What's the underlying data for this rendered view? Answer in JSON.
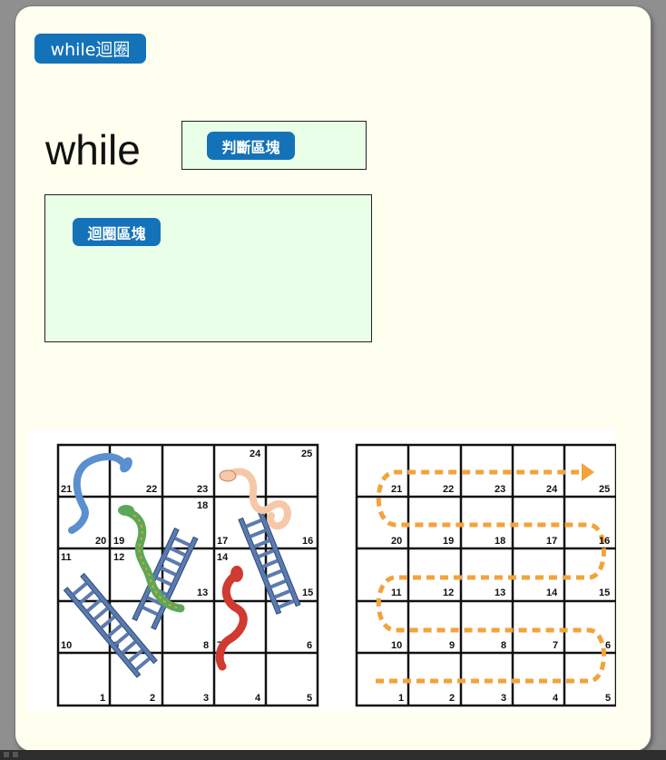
{
  "title_badge": "while迴圈",
  "syntax": {
    "keyword": "while",
    "condition_label": "判斷區塊",
    "body_label": "迴圈區塊"
  },
  "boards": {
    "left": {
      "rows": [
        [
          "",
          "",
          "",
          "24",
          "25"
        ],
        [
          "21",
          "22",
          "23",
          "",
          ""
        ],
        [
          "20",
          "19",
          "18",
          "17",
          "16"
        ],
        [
          "11",
          "12",
          "13",
          "14",
          "15"
        ],
        [
          "10",
          "9",
          "8",
          "7",
          "6"
        ],
        [
          "1",
          "2",
          "3",
          "4",
          "5"
        ]
      ]
    },
    "right": {
      "rows": [
        [
          "21",
          "22",
          "23",
          "24",
          "25"
        ],
        [
          "20",
          "19",
          "18",
          "17",
          "16"
        ],
        [
          "11",
          "12",
          "13",
          "14",
          "15"
        ],
        [
          "10",
          "9",
          "8",
          "7",
          "6"
        ],
        [
          "1",
          "2",
          "3",
          "4",
          "5"
        ]
      ]
    }
  },
  "colors": {
    "badge": "#1472b8",
    "block_fill": "#eaffe8",
    "card": "#fffff0",
    "path": "#f2a33a",
    "ladder": "#5b7bb0"
  }
}
